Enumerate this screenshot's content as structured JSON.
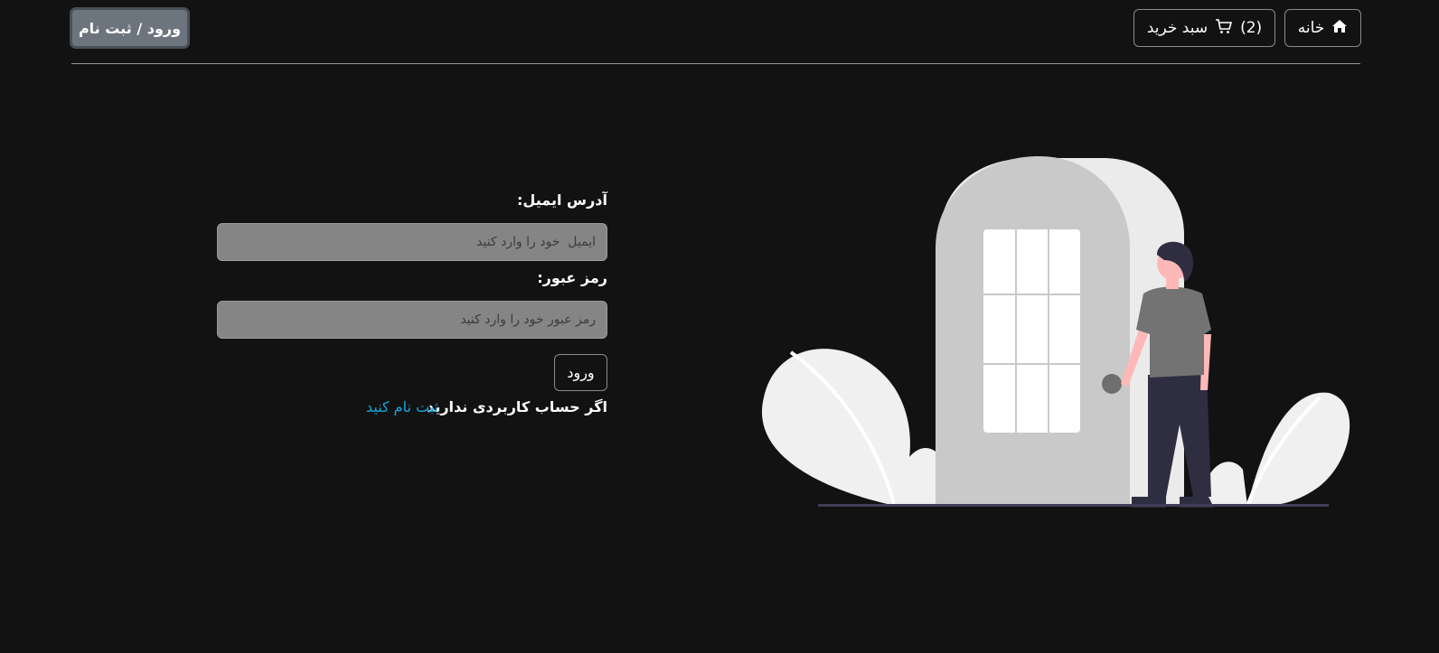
{
  "nav": {
    "home_label": "خانه",
    "cart_label": "سبد خرید",
    "cart_count": "(2)",
    "login_register_label": "ورود / ثبت نام"
  },
  "form": {
    "email_label": "آدرس ایمیل:",
    "email_placeholder": "ایمیل  خود را وارد کنید",
    "email_value": "",
    "password_label": "رمز عبور:",
    "password_placeholder": "رمز عبور خود را وارد کنید",
    "password_value": "",
    "submit_label": "ورود",
    "no_account_text": "اگر حساب کاربردی ندارید",
    "register_link": "ثبت نام کنید"
  },
  "icons": {
    "home": "home-icon",
    "cart": "cart-icon"
  },
  "colors": {
    "background": "#121212",
    "link": "#1aa3d9",
    "primary_button": "#6c757d"
  }
}
